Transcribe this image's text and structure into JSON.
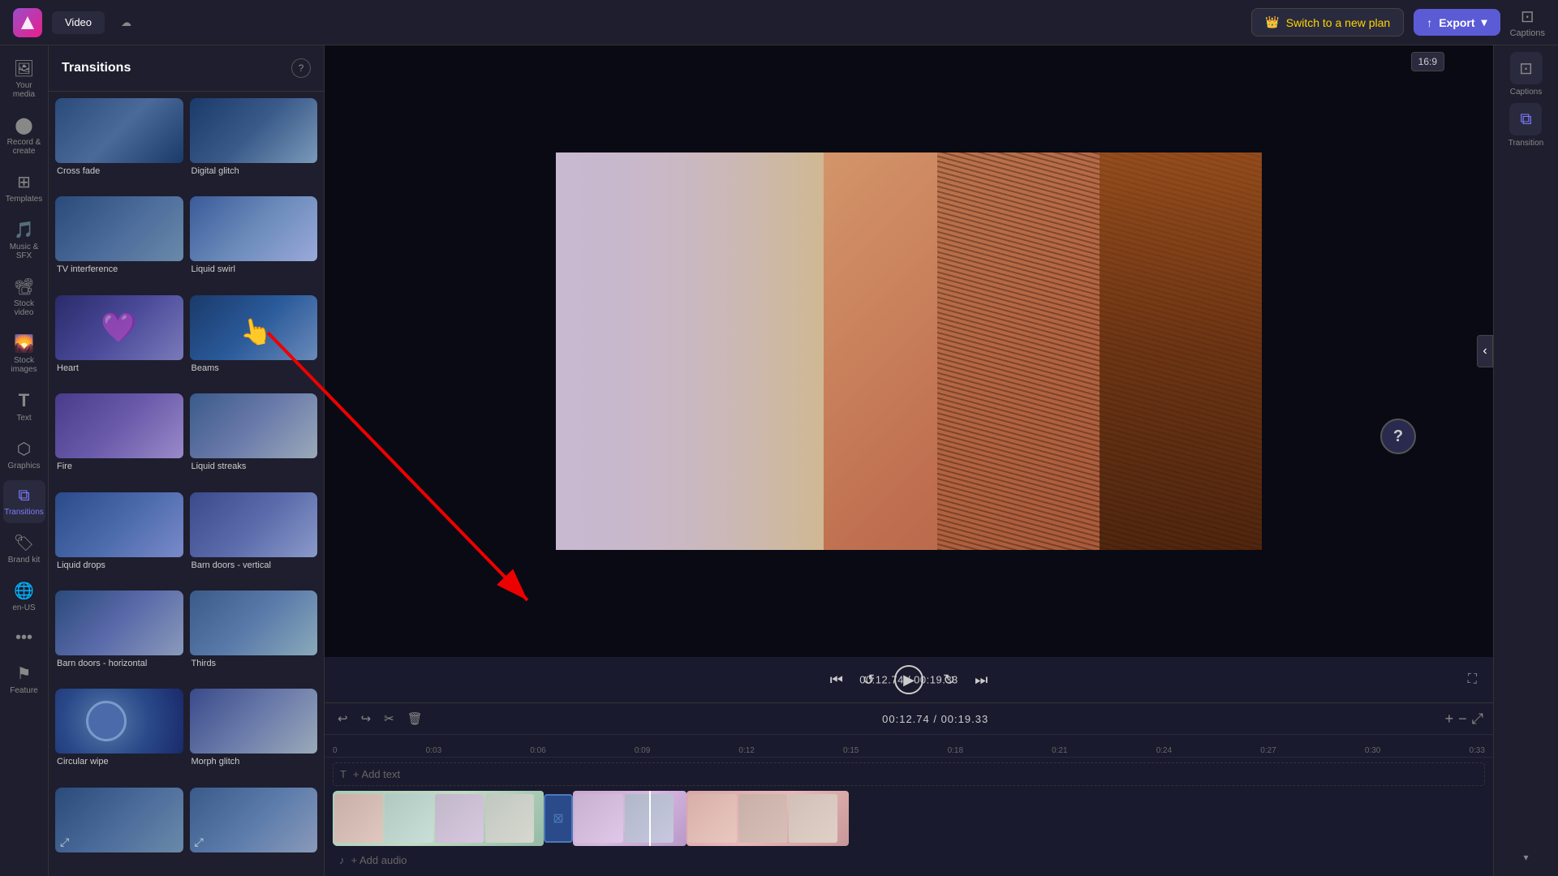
{
  "topbar": {
    "logo": "🎬",
    "tabs": [
      {
        "label": "Video",
        "active": true
      },
      {
        "label": "☁",
        "active": false
      }
    ],
    "switch_plan_label": "Switch to a new plan",
    "export_label": "Export",
    "captions_label": "Captions",
    "aspect_ratio": "16:9"
  },
  "nav": {
    "items": [
      {
        "id": "your-media",
        "label": "Your media",
        "icon": "🖼",
        "active": false
      },
      {
        "id": "record-create",
        "label": "Record & create",
        "icon": "🎥",
        "active": false
      },
      {
        "id": "templates",
        "label": "Templates",
        "icon": "⊞",
        "active": false
      },
      {
        "id": "music-sfx",
        "label": "Music & SFX",
        "icon": "🎵",
        "active": false
      },
      {
        "id": "stock-video",
        "label": "Stock video",
        "icon": "📽",
        "active": false
      },
      {
        "id": "stock-images",
        "label": "Stock images",
        "icon": "🌄",
        "active": false
      },
      {
        "id": "text",
        "label": "Text",
        "icon": "T",
        "active": false
      },
      {
        "id": "graphics",
        "label": "Graphics",
        "icon": "⬡",
        "active": false
      },
      {
        "id": "transitions",
        "label": "Transitions",
        "icon": "⧉",
        "active": true
      },
      {
        "id": "brand-kit",
        "label": "Brand kit",
        "icon": "🏷",
        "active": false
      },
      {
        "id": "language",
        "label": "en-US",
        "icon": "🌐",
        "active": false
      },
      {
        "id": "more",
        "label": "...",
        "icon": "•••",
        "active": false
      },
      {
        "id": "feature",
        "label": "Feature",
        "icon": "⚑",
        "active": false
      }
    ]
  },
  "transitions_panel": {
    "title": "Transitions",
    "help_icon": "?",
    "items": [
      {
        "id": "cross-fade",
        "label": "Cross fade",
        "thumb_class": "thumb-cross-fade"
      },
      {
        "id": "digital-glitch",
        "label": "Digital glitch",
        "thumb_class": "thumb-digital-glitch"
      },
      {
        "id": "tv-interference",
        "label": "TV interference",
        "thumb_class": "thumb-tv-interference"
      },
      {
        "id": "liquid-swirl",
        "label": "Liquid swirl",
        "thumb_class": "thumb-liquid-swirl"
      },
      {
        "id": "heart",
        "label": "Heart",
        "thumb_class": "thumb-heart",
        "overlay": "heart"
      },
      {
        "id": "beams",
        "label": "Beams",
        "thumb_class": "thumb-beams"
      },
      {
        "id": "fire",
        "label": "Fire",
        "thumb_class": "thumb-fire"
      },
      {
        "id": "liquid-streaks",
        "label": "Liquid streaks",
        "thumb_class": "thumb-liquid-streaks"
      },
      {
        "id": "liquid-drops",
        "label": "Liquid drops",
        "thumb_class": "thumb-liquid-drops"
      },
      {
        "id": "barn-doors-vertical",
        "label": "Barn doors - vertical",
        "thumb_class": "thumb-barn-doors-v"
      },
      {
        "id": "barn-doors-horizontal",
        "label": "Barn doors - horizontal",
        "thumb_class": "thumb-barn-doors-h"
      },
      {
        "id": "thirds",
        "label": "Thirds",
        "thumb_class": "thumb-thirds"
      },
      {
        "id": "circular-wipe",
        "label": "Circular wipe",
        "thumb_class": "thumb-circular-wipe",
        "overlay": "circle"
      },
      {
        "id": "morph-glitch",
        "label": "Morph glitch",
        "thumb_class": "thumb-morph-glitch"
      },
      {
        "id": "unknown1",
        "label": "",
        "thumb_class": "thumb-unknown1",
        "overlay": "expand"
      },
      {
        "id": "unknown2",
        "label": "",
        "thumb_class": "thumb-unknown2",
        "overlay": "expand2"
      }
    ]
  },
  "video_controls": {
    "time_current": "00:12.74",
    "time_total": "00:19.33",
    "time_display": "00:12.74 / 00:19.33"
  },
  "timeline": {
    "toolbar": {
      "undo": "↩",
      "redo": "↪",
      "cut": "✂",
      "delete": "🗑"
    },
    "time_display": "00:12.74 / 00:19.33",
    "ruler_marks": [
      "0",
      "0:03",
      "0:06",
      "0:09",
      "0:12",
      "0:15",
      "0:18",
      "0:21",
      "0:24",
      "0:27",
      "0:30",
      "0:33"
    ],
    "add_text_label": "+ Add text",
    "add_audio_label": "+ Add audio",
    "zoom_in": "+",
    "zoom_out": "−"
  },
  "right_panel": {
    "captions_label": "Captions",
    "transition_label": "Transition"
  }
}
